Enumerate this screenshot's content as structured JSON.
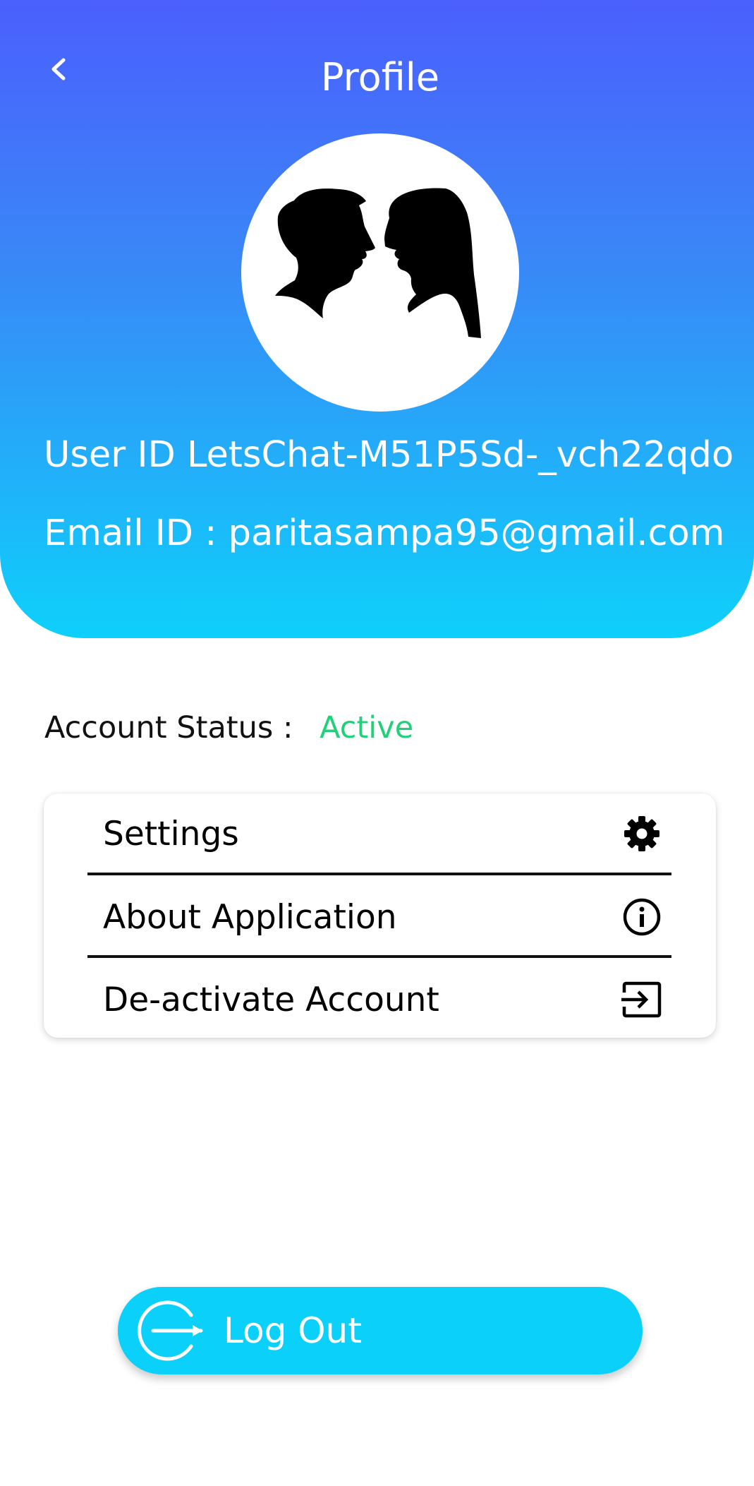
{
  "header": {
    "title": "Profile",
    "back_icon": "chevron-left-icon",
    "gradient_top": "#4b5ffd",
    "gradient_bottom": "#0ed0fb"
  },
  "avatar": {
    "icon": "couple-silhouette-avatar"
  },
  "profile": {
    "user_id": "User ID LetsChat-M51P5Sd-_vch22qdo",
    "email": "Email ID : paritasampa95@gmail.com"
  },
  "account_status": {
    "label": "Account Status :",
    "value": "Active",
    "value_color": "#22d07a"
  },
  "menu": {
    "items": [
      {
        "label": "Settings",
        "icon": "gear-icon"
      },
      {
        "label": "About Application",
        "icon": "info-icon"
      },
      {
        "label": "De-activate Account",
        "icon": "exit-to-app-icon"
      }
    ]
  },
  "logout": {
    "label": "Log Out",
    "icon": "logout-icon",
    "color": "#0bd0fa"
  }
}
